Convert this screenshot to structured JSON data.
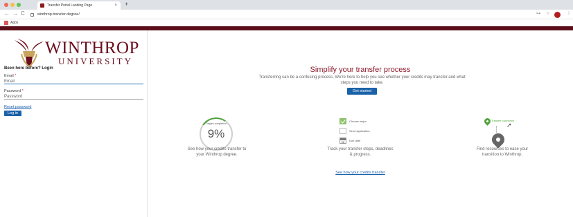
{
  "browser": {
    "tab_title": "Transfer Portal Landing Page",
    "tab_close": "×",
    "new_tab": "+",
    "url": "winthrop.transfer.degree/",
    "bookmark_apps": "Apps",
    "nav": {
      "back": "←",
      "forward": "→",
      "reload": "C"
    },
    "toolbar_icons": {
      "key": "⊶",
      "star": "☆",
      "menu": "⋮"
    }
  },
  "logo": {
    "name": "WINTHROP",
    "sub": "UNIVERSITY",
    "color": "#6b0e1e"
  },
  "login": {
    "title": "Been here before? Login",
    "email_label": "Email",
    "email_placeholder": "Email",
    "password_label": "Password",
    "password_placeholder": "Password",
    "required_mark": "*",
    "reset_link": "Reset password",
    "login_button": "Log in"
  },
  "hero": {
    "title": "Simplify your transfer process",
    "subtitle": "Transferring can be a confusing process. We're here to help you see whether your credits may transfer and what steps you need to take.",
    "button": "Get started"
  },
  "features": {
    "degree": {
      "ring_label": "Degree completion",
      "percent": "9%",
      "progress_value": 0.09,
      "description": "See how your credits transfer to your Winthrop degree."
    },
    "steps": {
      "items": [
        {
          "label": "Choose major",
          "state": "done"
        },
        {
          "label": "Send application",
          "state": "todo"
        },
        {
          "label": "Due date",
          "state": "calendar",
          "day": "26"
        }
      ],
      "description": "Track your transfer steps, deadlines & progress."
    },
    "resources": {
      "pin_label": "Transfer counselor",
      "description": "Find resources to ease your transition to Winthrop."
    }
  },
  "bottom_link": "See how your credits transfer",
  "colors": {
    "accent_blue": "#1a62a8",
    "brand_maroon": "#6b0e1e",
    "success_green": "#4fa43c"
  }
}
